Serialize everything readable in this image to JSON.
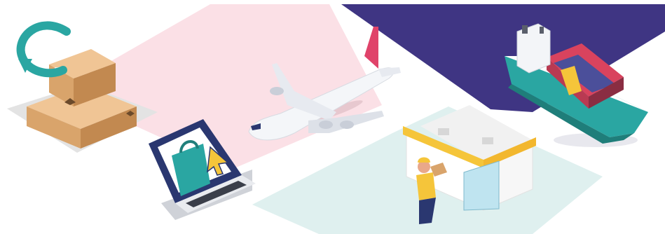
{
  "scene": {
    "illustrations": [
      "returns-box-icon",
      "online-shopping-laptop",
      "airplane",
      "cargo-ship",
      "delivery-courier-store"
    ]
  },
  "colors": {
    "pink_zone": "#fbe0e6",
    "purple_zone": "#3f3583",
    "mint_zone": "#dff0ef",
    "gray_zone": "#e3e3e3",
    "teal": "#2aa6a2",
    "box_brown": "#d9a46b",
    "ship_red": "#d9435e",
    "plane_tail": "#e0436a",
    "courier_yellow": "#f5c53a"
  }
}
